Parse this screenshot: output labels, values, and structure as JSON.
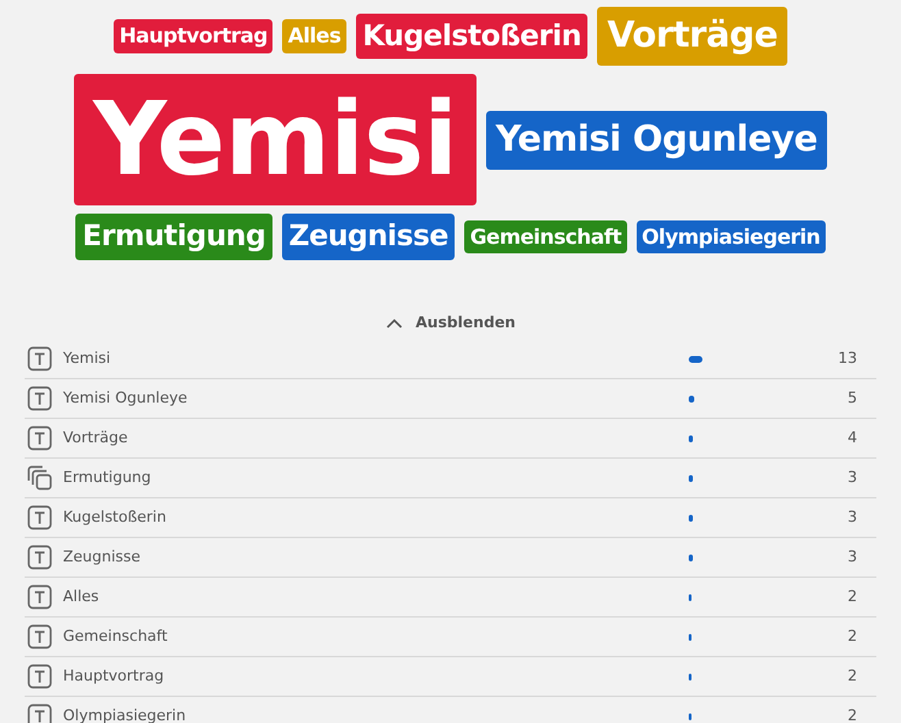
{
  "cloud": {
    "lines": [
      {
        "words": [
          {
            "text": "Hauptvortrag",
            "color": "#e11d3c",
            "kind": "small"
          },
          {
            "text": "Alles",
            "color": "#d89e00",
            "kind": "small"
          },
          {
            "text": "Kugelstoßerin",
            "color": "#e11d3c",
            "kind": "medium"
          },
          {
            "text": "Vorträge",
            "color": "#d89e00",
            "kind": "large"
          }
        ]
      },
      {
        "words": [
          {
            "text": "Yemisi",
            "color": "#e11d3c",
            "kind": "huge"
          },
          {
            "text": "Yemisi Ogunleye",
            "color": "#1565c8",
            "kind": "large"
          }
        ]
      },
      {
        "words": [
          {
            "text": "Ermutigung",
            "color": "#2a8a1a",
            "kind": "medium"
          },
          {
            "text": "Zeugnisse",
            "color": "#1565c8",
            "kind": "medium"
          },
          {
            "text": "Gemeinschaft",
            "color": "#2a8a1a",
            "kind": "small"
          },
          {
            "text": "Olympiasiegerin",
            "color": "#1565c8",
            "kind": "small"
          }
        ]
      }
    ]
  },
  "toggle": {
    "label": "Ausblenden",
    "expanded": true
  },
  "rows": [
    {
      "kind": "text",
      "label": "Yemisi",
      "count": "13"
    },
    {
      "kind": "text",
      "label": "Yemisi Ogunleye",
      "count": "5"
    },
    {
      "kind": "text",
      "label": "Vorträge",
      "count": "4"
    },
    {
      "kind": "multi",
      "label": "Ermutigung",
      "count": "3"
    },
    {
      "kind": "text",
      "label": "Kugelstoßerin",
      "count": "3"
    },
    {
      "kind": "text",
      "label": "Zeugnisse",
      "count": "3"
    },
    {
      "kind": "text",
      "label": "Alles",
      "count": "2"
    },
    {
      "kind": "text",
      "label": "Gemeinschaft",
      "count": "2"
    },
    {
      "kind": "text",
      "label": "Hauptvortrag",
      "count": "2"
    },
    {
      "kind": "text",
      "label": "Olympiasiegerin",
      "count": "2"
    }
  ]
}
